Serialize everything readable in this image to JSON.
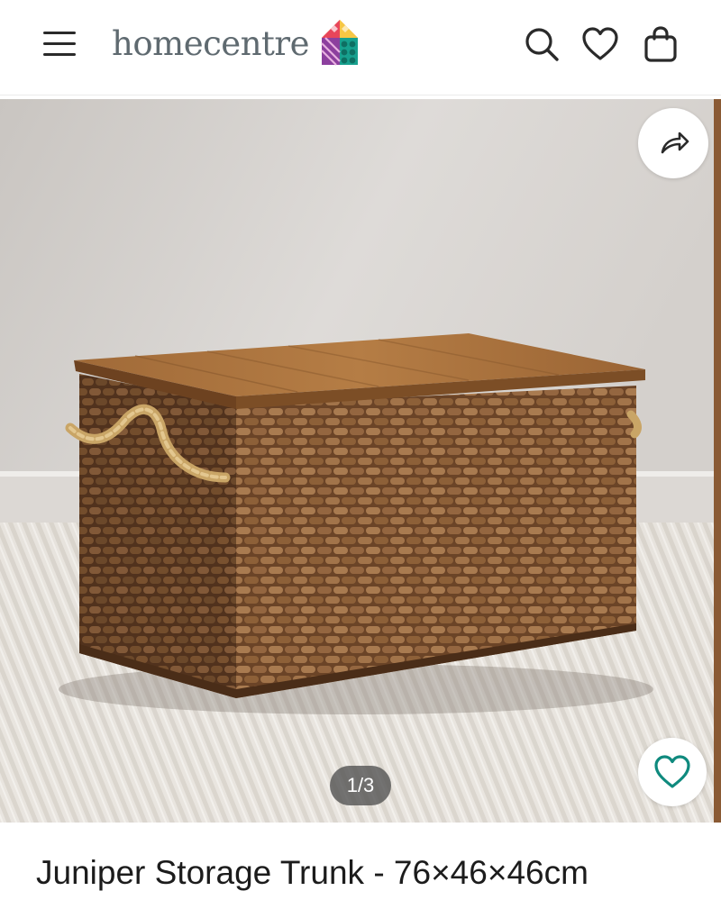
{
  "header": {
    "brand_name": "homecentre",
    "icons": [
      "menu-icon",
      "search-icon",
      "heart-icon",
      "shopping-bag-icon"
    ]
  },
  "gallery": {
    "counter": "1/3",
    "share_icon": "share-icon",
    "wishlist_icon": "heart-icon"
  },
  "product": {
    "title": "Juniper Storage Trunk - 76×46×46cm"
  },
  "colors": {
    "logo_text": "#5f6a70",
    "wishlist_accent": "#0f8a7e",
    "icon_dark": "#2a2a2a"
  }
}
